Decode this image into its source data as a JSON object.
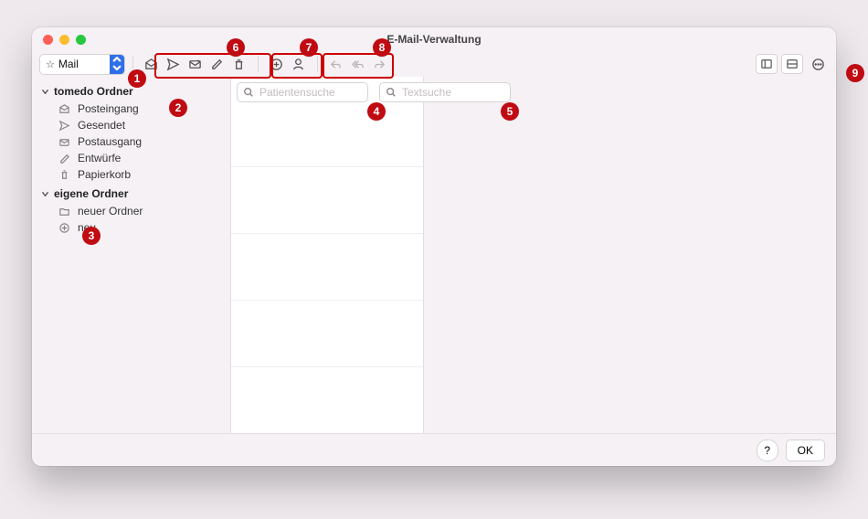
{
  "window": {
    "title": "E-Mail-Verwaltung"
  },
  "toolbar": {
    "account_selector_label": "Mail"
  },
  "sidebar": {
    "groups": [
      {
        "label": "tomedo Ordner",
        "items": [
          {
            "label": "Posteingang",
            "icon": "inbox"
          },
          {
            "label": "Gesendet",
            "icon": "sent"
          },
          {
            "label": "Postausgang",
            "icon": "outbox"
          },
          {
            "label": "Entwürfe",
            "icon": "draft"
          },
          {
            "label": "Papierkorb",
            "icon": "trash"
          }
        ]
      },
      {
        "label": "eigene Ordner",
        "items": [
          {
            "label": "neuer Ordner",
            "icon": "folder"
          },
          {
            "label": "neu",
            "icon": "add"
          }
        ]
      }
    ]
  },
  "search": {
    "patient_placeholder": "Patientensuche",
    "text_placeholder": "Textsuche"
  },
  "footer": {
    "help_label": "?",
    "ok_label": "OK"
  },
  "callouts": [
    "1",
    "2",
    "3",
    "4",
    "5",
    "6",
    "7",
    "8",
    "9"
  ]
}
